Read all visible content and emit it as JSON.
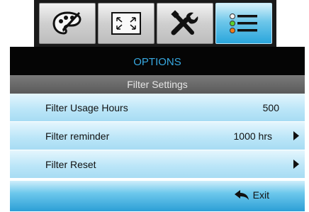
{
  "tabs": [
    {
      "icon": "palette-icon",
      "active": false
    },
    {
      "icon": "screen-resize-icon",
      "active": false
    },
    {
      "icon": "tools-icon",
      "active": false
    },
    {
      "icon": "options-list-icon",
      "active": true
    }
  ],
  "menu": {
    "title": "OPTIONS",
    "subtitle": "Filter Settings",
    "rows": [
      {
        "label": "Filter Usage Hours",
        "value": "500",
        "has_arrow": false
      },
      {
        "label": "Filter reminder",
        "value": "1000 hrs",
        "has_arrow": true
      },
      {
        "label": "Filter Reset",
        "value": "",
        "has_arrow": true
      }
    ],
    "exit_label": "Exit"
  },
  "colors": {
    "title_text": "#37a8e0",
    "accent": "#2aa6dc"
  }
}
